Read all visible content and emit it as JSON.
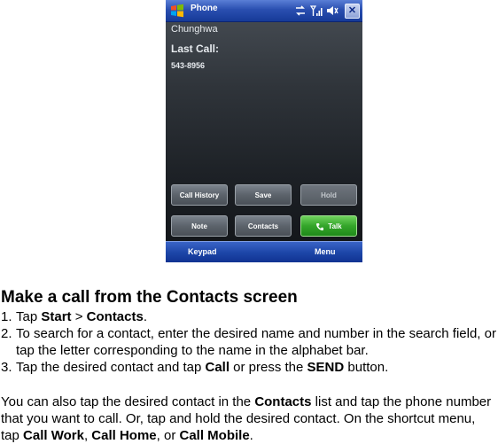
{
  "phone": {
    "title": "Phone",
    "close_label": "✕",
    "contact_name": "Chunghwa",
    "last_call_label": "Last Call:",
    "last_call_number": "543-8956",
    "buttons": {
      "call_history": "Call History",
      "save": "Save",
      "hold": "Hold",
      "note": "Note",
      "contacts": "Contacts",
      "talk": "Talk"
    },
    "softkeys": {
      "left": "Keypad",
      "right": "Menu"
    },
    "colors": {
      "title_bar": "#2a4fb0",
      "talk_button": "#34a52a",
      "screen": "#2f343a"
    }
  },
  "doc": {
    "heading": "Make a call from the Contacts screen",
    "steps": [
      {
        "num": "1.",
        "parts": [
          "Tap ",
          "Start",
          " > ",
          "Contacts",
          "."
        ]
      },
      {
        "num": "2.",
        "text": "To search for a contact, enter the desired name and number in the search field, or tap the letter corresponding to the name in the alphabet bar."
      },
      {
        "num": "3.",
        "parts": [
          "Tap the desired contact and tap ",
          "Call",
          " or press the ",
          "SEND",
          " button."
        ]
      }
    ],
    "paragraph": {
      "parts": [
        "You can also tap the desired contact in the ",
        "Contacts",
        " list and tap the phone number that you want to call. Or, tap and hold the desired contact. On the shortcut menu, tap ",
        "Call Work",
        ", ",
        "Call Home",
        ", or ",
        "Call Mobile",
        "."
      ]
    }
  }
}
